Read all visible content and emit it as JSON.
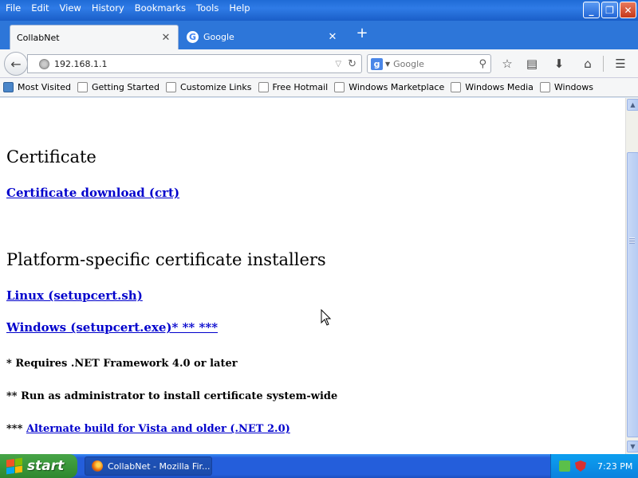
{
  "menu": [
    "File",
    "Edit",
    "View",
    "History",
    "Bookmarks",
    "Tools",
    "Help"
  ],
  "tabs": [
    {
      "label": "CollabNet",
      "active": true
    },
    {
      "label": "Google",
      "active": false
    }
  ],
  "nav": {
    "url": "192.168.1.1",
    "search_placeholder": "Google"
  },
  "bookmarks": [
    "Most Visited",
    "Getting Started",
    "Customize Links",
    "Free Hotmail",
    "Windows Marketplace",
    "Windows Media",
    "Windows"
  ],
  "page": {
    "heading1": "Certificate",
    "cert_link": "Certificate download (crt)",
    "heading2": "Platform-specific certificate installers",
    "linux_link": "Linux (setupcert.sh)",
    "windows_link": "Windows (setupcert.exe)* ** ***",
    "note1": "* Requires .NET Framework 4.0 or later",
    "note2": "** Run as administrator to install certificate system-wide",
    "note3_prefix": "***",
    "note3_link": "Alternate build for Vista and older (.NET 2.0)"
  },
  "taskbar": {
    "start_label": "start",
    "task_label": "CollabNet - Mozilla Fir...",
    "clock": "7:23 PM"
  },
  "colors": {
    "link": "#0000cc",
    "taskbar": "#245edb",
    "start": "#3c9a3c"
  }
}
